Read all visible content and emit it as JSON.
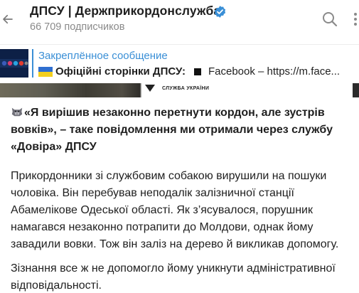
{
  "header": {
    "channel_name": "ДПСУ | Держприкордонслужба",
    "subscribers": "66 709 подписчиков",
    "icons": {
      "back": "arrow-left-icon",
      "verified": "verified-badge-icon",
      "search": "search-icon",
      "more": "more-vertical-icon"
    },
    "accent": "#3a8fd6"
  },
  "pinned": {
    "label": "Закреплённое сообщение",
    "text_strong": "Офіційні сторінки ДПСУ:",
    "text_rest": "Facebook – https://m.face...",
    "icons": {
      "flag": "ukraine-flag-icon",
      "square": "black-square-icon"
    }
  },
  "strip": {
    "brand_text": "СЛУЖБА УКРАЇНИ"
  },
  "message": {
    "lead": "«Я вирішив незаконно перетнути кордон, але зустрів вовків», – таке повідомлення ми отримали через службу «Довіра» ДПСУ",
    "lead_icon": "wolf-emoji-icon",
    "paragraph_1": "Прикордонники зі службовим собакою вирушили на пошуки чоловіка. Він перебував неподалік залізничної станції Абамелікове Одеської області. Як з’ясувалося, порушник намагався незаконно потрапити до Молдови, однак йому завадили вовки. Тож він заліз на дерево й викликав допомогу.",
    "paragraph_2": "Зізнання все ж не допомогло йому уникнути адміністративної відповідальності."
  }
}
